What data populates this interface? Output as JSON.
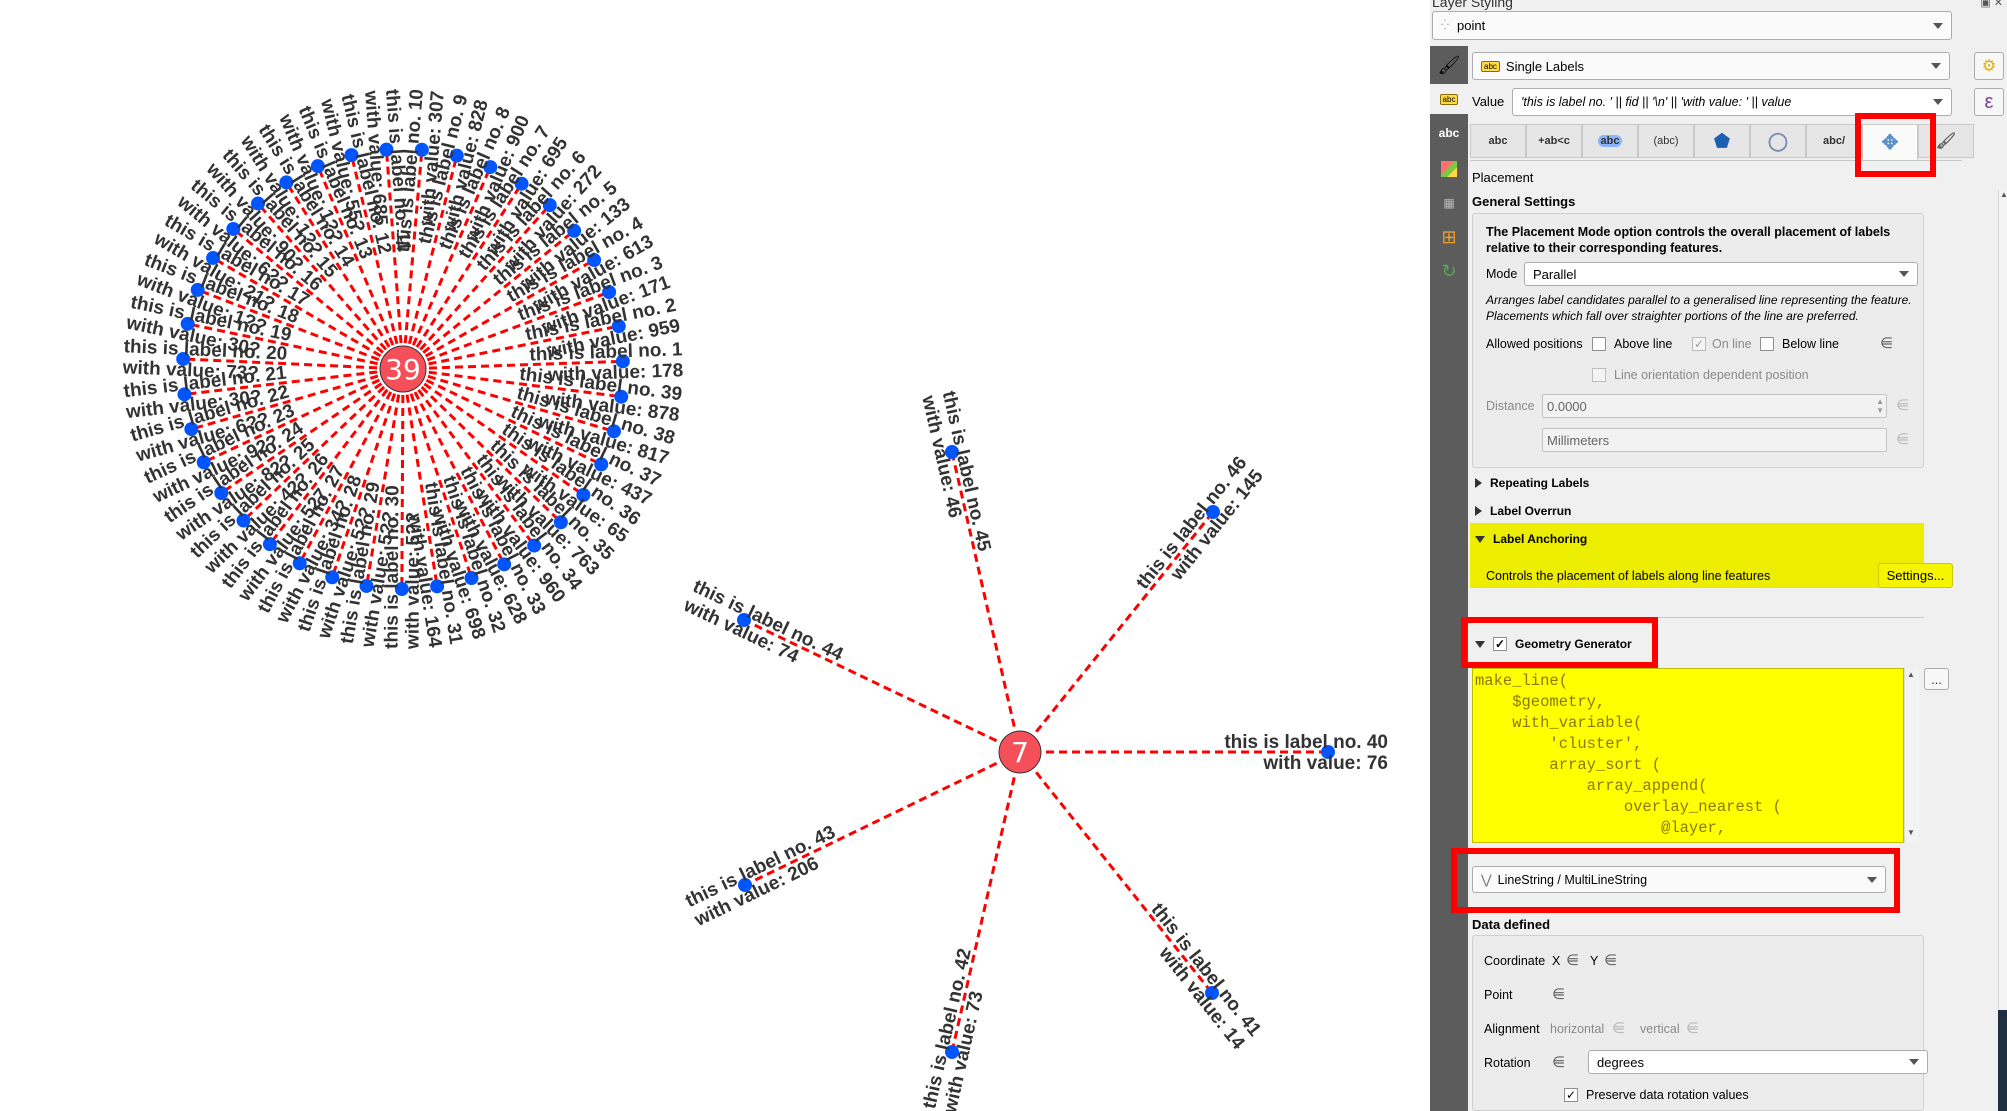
{
  "map": {
    "line_color": "#ff0000",
    "point_color": "#0055ff",
    "cluster_color": "#f5505a",
    "clusters": [
      {
        "count_label": "39",
        "labels": [
          {
            "no": 1,
            "value": "178"
          },
          {
            "no": 2,
            "value": "959"
          },
          {
            "no": 3,
            "value": "171"
          },
          {
            "no": 4,
            "value": "613"
          },
          {
            "no": 5,
            "value": "133"
          },
          {
            "no": 6,
            "value": "272"
          },
          {
            "no": 7,
            "value": "695"
          },
          {
            "no": 8,
            "value": "900"
          },
          {
            "no": 9,
            "value": "828"
          },
          {
            "no": 10,
            "value": "307"
          },
          {
            "no": 11,
            "value": "685"
          },
          {
            "no": 12,
            "value": "55?"
          },
          {
            "no": 13,
            "value": "1??"
          },
          {
            "no": 14,
            "value": "1??"
          },
          {
            "no": 15,
            "value": "90?"
          },
          {
            "no": 16,
            "value": "6??"
          },
          {
            "no": 17,
            "value": "21?"
          },
          {
            "no": 18,
            "value": "1??"
          },
          {
            "no": 19,
            "value": "30?"
          },
          {
            "no": 20,
            "value": "73?"
          },
          {
            "no": 21,
            "value": "30?"
          },
          {
            "no": 22,
            "value": "6??"
          },
          {
            "no": 23,
            "value": "92?"
          },
          {
            "no": 24,
            "value": "82?"
          },
          {
            "no": 25,
            "value": "42?"
          },
          {
            "no": 26,
            "value": "527"
          },
          {
            "no": 27,
            "value": "34?"
          },
          {
            "no": 28,
            "value": "5??"
          },
          {
            "no": 29,
            "value": "5??"
          },
          {
            "no": 30,
            "value": "5??"
          },
          {
            "no": 31,
            "value": "164"
          },
          {
            "no": 32,
            "value": "698"
          },
          {
            "no": 33,
            "value": "628"
          },
          {
            "no": 34,
            "value": "960"
          },
          {
            "no": 35,
            "value": "763"
          },
          {
            "no": 36,
            "value": "65"
          },
          {
            "no": 37,
            "value": "437"
          },
          {
            "no": 38,
            "value": "817"
          },
          {
            "no": 39,
            "value": "878"
          }
        ]
      },
      {
        "count_label": "7",
        "labels": [
          {
            "no": 40,
            "value": "76"
          },
          {
            "no": 41,
            "value": "14"
          },
          {
            "no": 42,
            "value": "73"
          },
          {
            "no": 43,
            "value": "206"
          },
          {
            "no": 44,
            "value": "74"
          },
          {
            "no": 45,
            "value": "46"
          },
          {
            "no": 46,
            "value": "145"
          }
        ]
      }
    ],
    "label_prefix": "this is label no. ",
    "value_prefix": "with value: "
  },
  "panel": {
    "title": "Layer Styling",
    "window_buttons": "▣ ✕",
    "layer_select": "point",
    "renderer_select": "Single Labels",
    "value_label": "Value",
    "value_expression": "'this is label no. ' || fid  ||  '\\n'  || 'with value: ' ||  value",
    "expression_button": "ε",
    "tabs": [
      {
        "name": "text",
        "glyph": "abc"
      },
      {
        "name": "formatting",
        "glyph": "+ab<c"
      },
      {
        "name": "buffer",
        "glyph": "abc"
      },
      {
        "name": "mask",
        "glyph": "(abc)"
      },
      {
        "name": "background",
        "glyph": "⬟"
      },
      {
        "name": "shadow",
        "glyph": "◯"
      },
      {
        "name": "callouts",
        "glyph": "abc/"
      },
      {
        "name": "placement",
        "glyph": "✥"
      },
      {
        "name": "rendering",
        "glyph": "🖌"
      }
    ],
    "active_tab": "placement",
    "section_label": "Placement",
    "general_settings": {
      "title": "General Settings",
      "description": "The Placement Mode option controls the overall placement of labels relative to their corresponding features.",
      "mode_label": "Mode",
      "mode_value": "Parallel",
      "mode_help": "Arranges label candidates parallel to a generalised line representing the feature. Placements which fall over straighter portions of the line are preferred.",
      "allowed_positions_label": "Allowed positions",
      "above_line": {
        "label": "Above line",
        "checked": false
      },
      "on_line": {
        "label": "On line",
        "checked": true
      },
      "below_line": {
        "label": "Below line",
        "checked": false
      },
      "line_orientation": {
        "label": "Line orientation dependent position",
        "checked": false
      },
      "distance_label": "Distance",
      "distance_value": "0.0000",
      "distance_unit": "Millimeters"
    },
    "repeating_labels": "Repeating Labels",
    "label_overrun": "Label Overrun",
    "label_anchoring": {
      "title": "Label Anchoring",
      "description": "Controls the placement of labels along line features",
      "settings_button": "Settings..."
    },
    "geometry_generator": {
      "title": "Geometry Generator",
      "enabled": true,
      "expression_lines": [
        "make_line(",
        "    $geometry,",
        "    with_variable(",
        "        'cluster',",
        "        array_sort (",
        "            array_append(",
        "                overlay_nearest (",
        "                    @layer,"
      ],
      "more_button": "...",
      "geometry_type": "LineString / MultiLineString"
    },
    "data_defined": {
      "title": "Data defined",
      "coordinate_label": "Coordinate",
      "x_label": "X",
      "y_label": "Y",
      "point_label": "Point",
      "alignment_label": "Alignment",
      "horizontal_label": "horizontal",
      "vertical_label": "vertical",
      "rotation_label": "Rotation",
      "rotation_unit": "degrees",
      "preserve_rotation": {
        "label": "Preserve data rotation values",
        "checked": true
      }
    }
  }
}
